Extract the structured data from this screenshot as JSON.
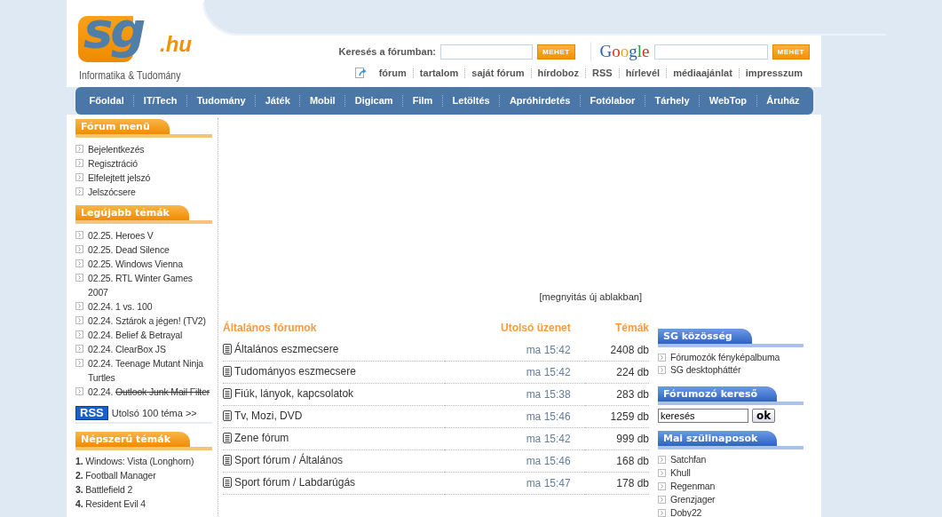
{
  "logo": {
    "mark": "sg",
    "suffix": ".hu",
    "tagline": "Informatika & Tudomány"
  },
  "forum_search": {
    "label": "Keresés a fórumban:",
    "button": "MEHET"
  },
  "google_search": {
    "logo": "Google",
    "button": "MEHET"
  },
  "top_links": [
    "fórum",
    "tartalom",
    "saját fórum",
    "hírdoboz",
    "RSS",
    "hírlevél",
    "médiaajánlat",
    "impresszum"
  ],
  "nav": [
    "Főoldal",
    "IT/Tech",
    "Tudomány",
    "Játék",
    "Mobil",
    "Digicam",
    "Film",
    "Letöltés",
    "Apróhirdetés",
    "Fotólabor",
    "Tárhely",
    "WebTop",
    "Áruház"
  ],
  "forum_menu": {
    "title": "Fórum menü",
    "items": [
      "Bejelentkezés",
      "Regisztráció",
      "Elfelejtett jelszó",
      "Jelszócsere"
    ]
  },
  "latest_topics": {
    "title": "Legújabb témák",
    "items": [
      {
        "date": "02.25.",
        "title": "Heroes V",
        "struck": false
      },
      {
        "date": "02.25.",
        "title": "Dead Silence",
        "struck": false
      },
      {
        "date": "02.25.",
        "title": "Windows Vienna",
        "struck": false
      },
      {
        "date": "02.25.",
        "title": "RTL Winter Games 2007",
        "struck": false
      },
      {
        "date": "02.24.",
        "title": "1 vs. 100",
        "struck": false
      },
      {
        "date": "02.24.",
        "title": "Sztárok a jégen! (TV2)",
        "struck": false
      },
      {
        "date": "02.24.",
        "title": "Belief & Betrayal",
        "struck": false
      },
      {
        "date": "02.24.",
        "title": "ClearBox JS",
        "struck": false
      },
      {
        "date": "02.24.",
        "title": "Teenage Mutant Ninja Turtles",
        "struck": false
      },
      {
        "date": "02.24.",
        "title": "Outlook Junk Mail Filter",
        "struck": true
      }
    ]
  },
  "rss_link": {
    "badge": "RSS",
    "text": "Utolsó 100 téma >>"
  },
  "popular": {
    "title": "Népszerű témák",
    "items": [
      {
        "rank": "1.",
        "title": "Windows: Vista (Longhorn)"
      },
      {
        "rank": "2.",
        "title": "Football Manager"
      },
      {
        "rank": "3.",
        "title": "Battlefield 2"
      },
      {
        "rank": "4.",
        "title": "Resident Evil 4"
      }
    ]
  },
  "ad": {
    "link": "[megnyitás új ablakban]"
  },
  "forums": {
    "columns": [
      "Általános fórumok",
      "Utolsó üzenet",
      "Témák"
    ],
    "rows": [
      {
        "name": "Általános eszmecsere",
        "last": "ma 15:42",
        "count": "2408 db"
      },
      {
        "name": "Tudományos eszmecsere",
        "last": "ma 15:42",
        "count": "224 db"
      },
      {
        "name": "Fiúk, lányok, kapcsolatok",
        "last": "ma 15:38",
        "count": "283 db"
      },
      {
        "name": "Tv, Mozi, DVD",
        "last": "ma 15:46",
        "count": "1259 db"
      },
      {
        "name": "Zene fórum",
        "last": "ma 15:42",
        "count": "999 db"
      },
      {
        "name": "Sport fórum / Általános",
        "last": "ma 15:46",
        "count": "168 db"
      },
      {
        "name": "Sport fórum / Labdarúgás",
        "last": "ma 15:47",
        "count": "178 db"
      }
    ]
  },
  "community": {
    "title": "SG közösség",
    "items": [
      "Fórumozók fényképalbuma",
      "SG desktopháttér"
    ]
  },
  "user_search": {
    "title": "Fórumozó kereső",
    "value": "keresés",
    "button": "ok"
  },
  "birthdays": {
    "title": "Mai szülinaposok",
    "items": [
      "Satchfan",
      "Khull",
      "Regenman",
      "Grenzjager",
      "Doby22"
    ]
  }
}
